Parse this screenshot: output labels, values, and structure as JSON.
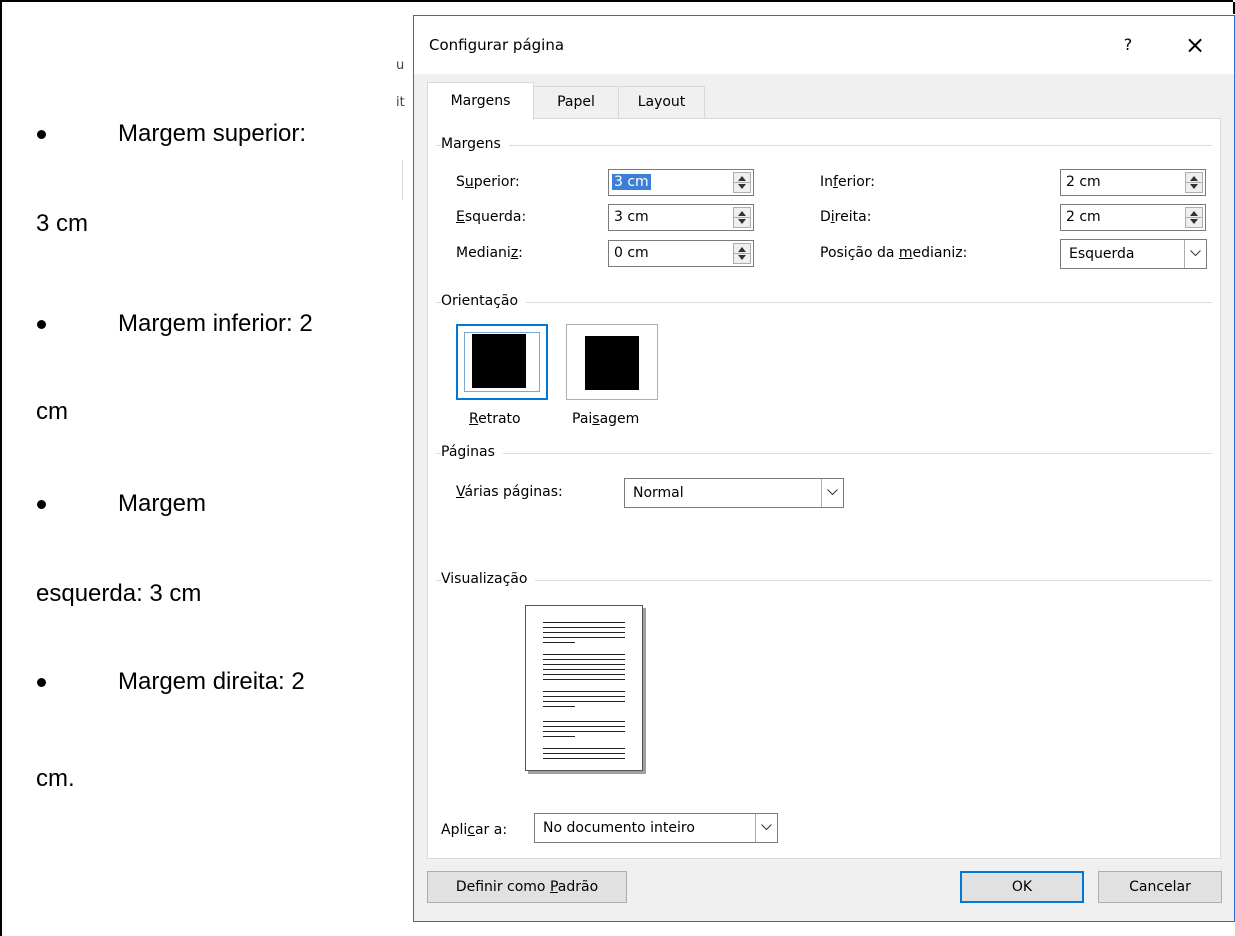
{
  "document": {
    "lines": [
      {
        "bullet": true,
        "text": "Margem superior:"
      },
      {
        "bullet": false,
        "text": "3 cm"
      },
      {
        "bullet": true,
        "text": "Margem inferior: 2"
      },
      {
        "bullet": false,
        "text": "cm"
      },
      {
        "bullet": true,
        "text": "Margem"
      },
      {
        "bullet": false,
        "text": "esquerda: 3 cm"
      },
      {
        "bullet": true,
        "text": "Margem direita: 2"
      },
      {
        "bullet": false,
        "text": "cm."
      }
    ],
    "clipped_glyphs": [
      "u",
      "it"
    ]
  },
  "dialog": {
    "title": "Configurar página",
    "help_label": "?",
    "close_label": "×",
    "tabs": [
      {
        "label": "Margens",
        "active": true
      },
      {
        "label": "Papel",
        "active": false
      },
      {
        "label": "Layout",
        "active": false
      }
    ],
    "margins": {
      "group_title": "Margens",
      "superior": {
        "pre": "S",
        "acc": "u",
        "post": "perior:",
        "value": "3 cm"
      },
      "esquerda": {
        "pre": "",
        "acc": "E",
        "post": "squerda:",
        "value": "3 cm"
      },
      "medianiz": {
        "pre": "Mediani",
        "acc": "z",
        "post": ":",
        "value": "0 cm"
      },
      "inferior": {
        "pre": "In",
        "acc": "f",
        "post": "erior:",
        "value": "2 cm"
      },
      "direita": {
        "pre": "D",
        "acc": "i",
        "post": "reita:",
        "value": "2 cm"
      },
      "posicao": {
        "pre": "Posição da ",
        "acc": "m",
        "post": "edianiz:",
        "value": "Esquerda"
      }
    },
    "orientation": {
      "group_title": "Orientação",
      "retrato": {
        "pre": "",
        "acc": "R",
        "post": "etrato"
      },
      "paisagem": {
        "pre": "Pai",
        "acc": "s",
        "post": "agem"
      }
    },
    "pages": {
      "group_title": "Páginas",
      "label": {
        "pre": "",
        "acc": "V",
        "post": "árias páginas:"
      },
      "value": "Normal"
    },
    "preview": {
      "group_title": "Visualização"
    },
    "apply": {
      "label": {
        "pre": "Apli",
        "acc": "c",
        "post": "ar a:"
      },
      "value": "No documento inteiro"
    },
    "buttons": {
      "set_default": {
        "pre": "Definir como ",
        "acc": "P",
        "post": "adrão"
      },
      "ok": "OK",
      "cancel": "Cancelar"
    }
  },
  "colors": {
    "accent": "#0078d7",
    "selection": "#3c7fd6",
    "dialog_border": "#2b6dc7"
  }
}
